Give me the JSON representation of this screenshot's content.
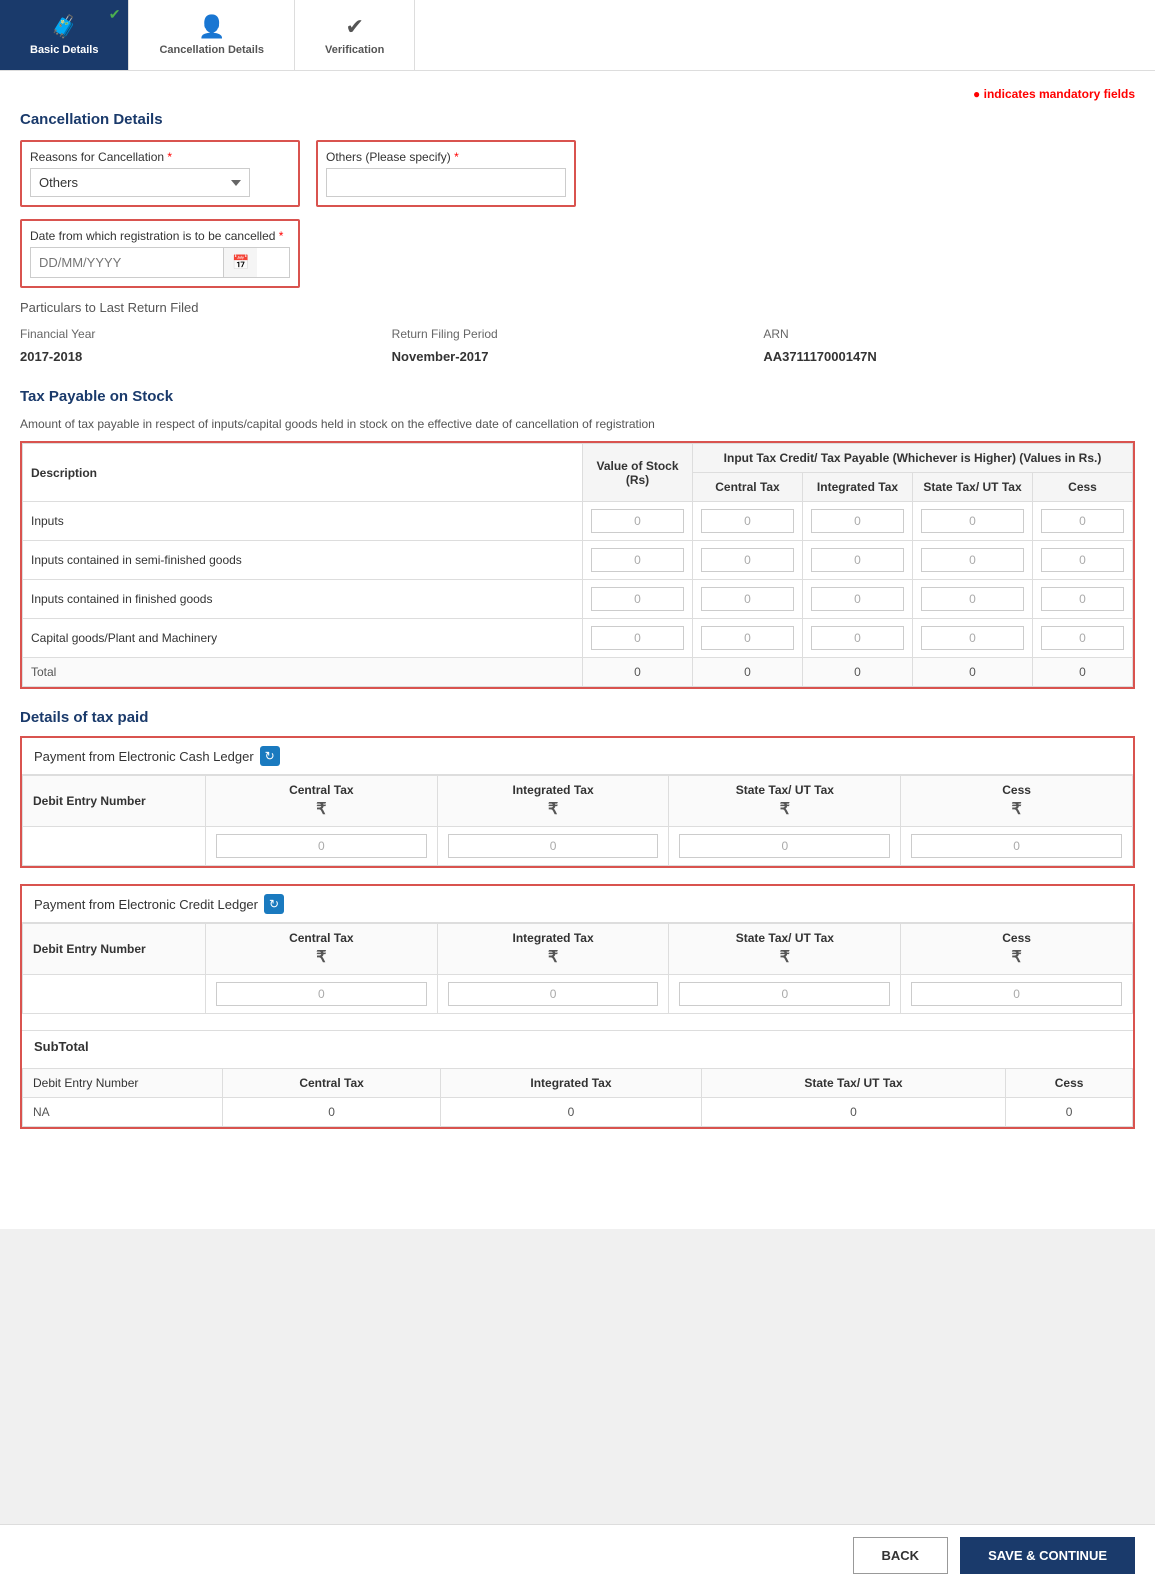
{
  "wizard": {
    "steps": [
      {
        "id": "basic-details",
        "label": "Basic Details",
        "icon": "🧳",
        "active": true,
        "checked": true
      },
      {
        "id": "cancellation-details",
        "label": "Cancellation Details",
        "icon": "👤",
        "active": false,
        "checked": false
      },
      {
        "id": "verification",
        "label": "Verification",
        "icon": "✔",
        "active": false,
        "checked": false
      }
    ]
  },
  "mandatory_note": "indicates mandatory fields",
  "cancellation_details": {
    "title": "Cancellation Details",
    "reasons_label": "Reasons for Cancellation",
    "reasons_value": "Others",
    "others_label": "Others (Please specify)",
    "others_placeholder": "",
    "date_label": "Date from which registration is to be cancelled",
    "date_placeholder": "DD/MM/YYYY"
  },
  "particulars": {
    "title": "Particulars to Last Return Filed",
    "financial_year_label": "Financial Year",
    "financial_year_value": "2017-2018",
    "return_period_label": "Return Filing Period",
    "return_period_value": "November-2017",
    "arn_label": "ARN",
    "arn_value": "AA371117000147N"
  },
  "tax_payable": {
    "title": "Tax Payable on Stock",
    "description": "Amount of tax payable in respect of inputs/capital goods held in stock on the effective date of cancellation of registration",
    "header_group": "Input Tax Credit/ Tax Payable (Whichever is Higher) (Values in Rs.)",
    "columns": {
      "description": "Description",
      "value_of_stock": "Value of Stock (Rs)",
      "central_tax": "Central Tax",
      "integrated_tax": "Integrated Tax",
      "state_tax": "State Tax/ UT Tax",
      "cess": "Cess"
    },
    "rows": [
      {
        "description": "Inputs",
        "value_of_stock": "0",
        "central_tax": "0",
        "integrated_tax": "0",
        "state_tax": "0",
        "cess": "0"
      },
      {
        "description": "Inputs contained in semi-finished goods",
        "value_of_stock": "0",
        "central_tax": "0",
        "integrated_tax": "0",
        "state_tax": "0",
        "cess": "0"
      },
      {
        "description": "Inputs contained in finished goods",
        "value_of_stock": "0",
        "central_tax": "0",
        "integrated_tax": "0",
        "state_tax": "0",
        "cess": "0"
      },
      {
        "description": "Capital goods/Plant and Machinery",
        "value_of_stock": "0",
        "central_tax": "0",
        "integrated_tax": "0",
        "state_tax": "0",
        "cess": "0"
      },
      {
        "description": "Total",
        "value_of_stock": "0",
        "central_tax": "0",
        "integrated_tax": "0",
        "state_tax": "0",
        "cess": "0"
      }
    ]
  },
  "tax_paid": {
    "title": "Details of tax paid",
    "cash_ledger": {
      "title": "Payment from Electronic Cash Ledger",
      "columns": {
        "debit_entry": "Debit Entry Number",
        "central_tax": "Central Tax",
        "integrated_tax": "Integrated Tax",
        "state_tax": "State Tax/ UT Tax",
        "cess": "Cess"
      },
      "row_value": "0",
      "row_central": "0",
      "row_integrated": "0",
      "row_state": "0",
      "row_cess": "0"
    },
    "credit_ledger": {
      "title": "Payment from Electronic Credit Ledger",
      "columns": {
        "debit_entry": "Debit Entry Number",
        "central_tax": "Central Tax",
        "integrated_tax": "Integrated Tax",
        "state_tax": "State Tax/ UT Tax",
        "cess": "Cess"
      },
      "row_central": "0",
      "row_integrated": "0",
      "row_state": "0",
      "row_cess": "0"
    },
    "subtotal": {
      "title": "SubTotal",
      "columns": {
        "debit_entry": "Debit Entry Number",
        "central_tax": "Central Tax",
        "integrated_tax": "Integrated Tax",
        "state_tax": "State Tax/ UT Tax",
        "cess": "Cess"
      },
      "row_na": "NA",
      "row_central": "0",
      "row_integrated": "0",
      "row_state": "0",
      "row_cess": "0"
    }
  },
  "footer": {
    "back_label": "BACK",
    "save_label": "SAVE & CONTINUE"
  }
}
